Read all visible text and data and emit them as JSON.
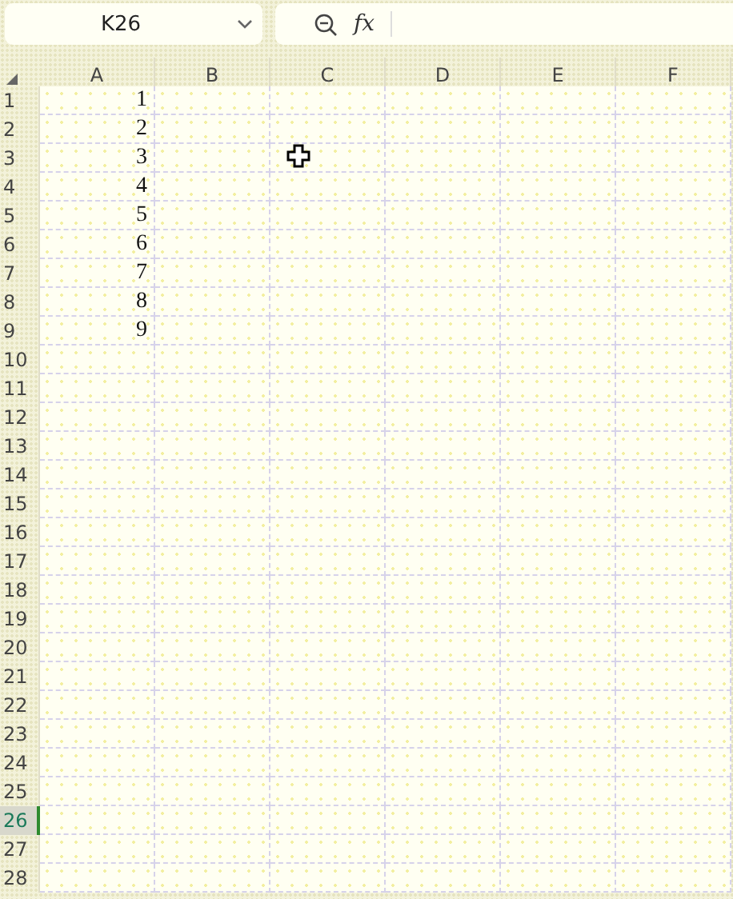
{
  "name_box": {
    "value": "K26"
  },
  "formula_bar": {
    "fx_label": "fx"
  },
  "columns": [
    {
      "label": "A",
      "selected": false
    },
    {
      "label": "B",
      "selected": false
    },
    {
      "label": "C",
      "selected": false
    },
    {
      "label": "D",
      "selected": false
    },
    {
      "label": "E",
      "selected": false
    },
    {
      "label": "F",
      "selected": false
    }
  ],
  "rows": [
    {
      "label": "1",
      "selected": false,
      "a": "1"
    },
    {
      "label": "2",
      "selected": false,
      "a": "2"
    },
    {
      "label": "3",
      "selected": false,
      "a": "3"
    },
    {
      "label": "4",
      "selected": false,
      "a": "4"
    },
    {
      "label": "5",
      "selected": false,
      "a": "5"
    },
    {
      "label": "6",
      "selected": false,
      "a": "6"
    },
    {
      "label": "7",
      "selected": false,
      "a": "7"
    },
    {
      "label": "8",
      "selected": false,
      "a": "8"
    },
    {
      "label": "9",
      "selected": false,
      "a": "9"
    },
    {
      "label": "10",
      "selected": false
    },
    {
      "label": "11",
      "selected": false
    },
    {
      "label": "12",
      "selected": false
    },
    {
      "label": "13",
      "selected": false
    },
    {
      "label": "14",
      "selected": false
    },
    {
      "label": "15",
      "selected": false
    },
    {
      "label": "16",
      "selected": false
    },
    {
      "label": "17",
      "selected": false
    },
    {
      "label": "18",
      "selected": false
    },
    {
      "label": "19",
      "selected": false
    },
    {
      "label": "20",
      "selected": false
    },
    {
      "label": "21",
      "selected": false
    },
    {
      "label": "22",
      "selected": false
    },
    {
      "label": "23",
      "selected": false
    },
    {
      "label": "24",
      "selected": false
    },
    {
      "label": "25",
      "selected": false
    },
    {
      "label": "26",
      "selected": true
    },
    {
      "label": "27",
      "selected": false
    },
    {
      "label": "28",
      "selected": false
    }
  ]
}
